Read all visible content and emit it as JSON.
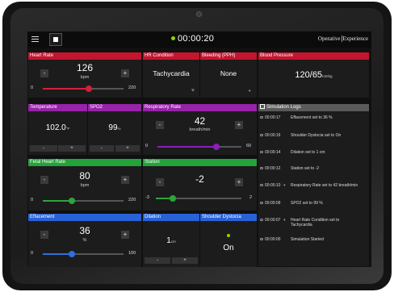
{
  "header": {
    "timer": "00:00:20",
    "brand_left": "Operative",
    "brand_right": "Experience"
  },
  "heart_rate": {
    "title": "Heart Rate",
    "value": "126",
    "unit": "bpm",
    "min": "0",
    "max": "220",
    "minus": "-",
    "plus": "+",
    "level": 0.57
  },
  "hr_condition": {
    "title": "HR Condition",
    "value": "Tachycardia"
  },
  "bleeding": {
    "title": "Bleeding (PPH)",
    "value": "None"
  },
  "blood_pressure": {
    "title": "Blood Pressure",
    "value": "120/65",
    "unit": "mmhg"
  },
  "temperature": {
    "title": "Temperature",
    "value": "102.0",
    "unit": "°F",
    "minus": "-",
    "plus": "+"
  },
  "spo2": {
    "title": "SPO2",
    "value": "99",
    "unit": "%",
    "minus": "-",
    "plus": "+"
  },
  "respiratory_rate": {
    "title": "Respiratory Rate",
    "value": "42",
    "unit": "breath/min",
    "min": "0",
    "max": "60",
    "minus": "-",
    "plus": "+",
    "level": 0.7
  },
  "fetal_heart_rate": {
    "title": "Fetal Heart Rate",
    "value": "80",
    "unit": "bpm",
    "min": "0",
    "max": "220",
    "minus": "-",
    "plus": "+",
    "level": 0.36
  },
  "station": {
    "title": "Station",
    "value": "-2",
    "min": "-3",
    "max": "2",
    "minus": "-",
    "plus": "+",
    "level": 0.2
  },
  "effacement": {
    "title": "Effacement",
    "value": "36",
    "unit": "%",
    "min": "0",
    "max": "100",
    "minus": "-",
    "plus": "+",
    "level": 0.36
  },
  "dilation": {
    "title": "Dilation",
    "value": "1",
    "unit": "cm",
    "minus": "-",
    "plus": "+"
  },
  "shoulder_dystocia": {
    "title": "Shoulder Dystocia",
    "value": "On"
  },
  "logs": {
    "title": "Simulation Logs",
    "entries": [
      {
        "time": "00:00:17",
        "msg": "Effacement set to 36 %"
      },
      {
        "time": "00:00:16",
        "msg": "Shoulder Dystocia set to On"
      },
      {
        "time": "00:00:14",
        "msg": "Dilation set to 1 cm"
      },
      {
        "time": "00:00:12",
        "msg": "Station set to -2"
      },
      {
        "time": "00:00:10",
        "msg": "Respiratory Rate set to 42 breath/min"
      },
      {
        "time": "00:00:09",
        "msg": "SPO2 set to 99 %"
      },
      {
        "time": "00:00:07",
        "msg": "Heart Rate Condition set to Tachycardia"
      },
      {
        "time": "00:00:00",
        "msg": "Simulation Started"
      }
    ]
  },
  "colors": {
    "red": "#c4152f",
    "purple": "#9623a8",
    "green": "#23a33a",
    "blue": "#2862d8",
    "timer_dot": "#8fd400"
  }
}
